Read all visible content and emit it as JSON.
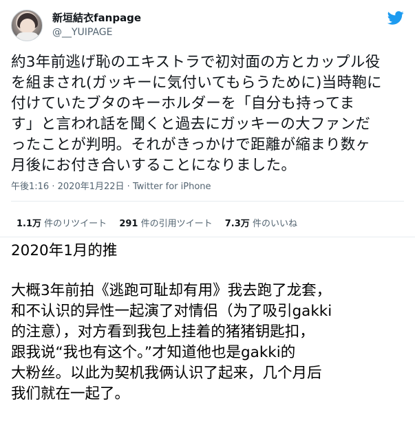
{
  "tweet": {
    "display_name": "新垣結衣fanpage",
    "handle": "@__YUIPAGE",
    "text_lines": [
      "約3年前逃げ恥のエキストラで初対面の方とカップル役",
      "を組まされ(ガッキーに気付いてもらうために)当時鞄に",
      "付けていたブタのキーホルダーを「自分も持ってま",
      "す」と言われ話を聞くと過去にガッキーの大ファンだ",
      "ったことが判明。それがきっかけで距離が縮まり数ヶ",
      "月後にお付き合いすることになりました。"
    ],
    "time": "午後1:16",
    "date": "2020年1月22日",
    "source": "Twitter for iPhone",
    "separator": "·",
    "stats": {
      "retweets_count": "1.1万",
      "retweets_label": "件のリツイート",
      "quotes_count": "291",
      "quotes_label": "件の引用ツイート",
      "likes_count": "7.3万",
      "likes_label": "件のいいね"
    },
    "brand_color": "#1d9bf0"
  },
  "caption": {
    "title": "2020年1月的推",
    "lines": [
      "大概3年前拍《逃跑可耻却有用》我去跑了龙套，",
      "和不认识的异性一起演了对情侣（为了吸引gakki",
      "的注意），对方看到我包上挂着的猪猪钥匙扣，",
      "跟我说“我也有这个。”才知道他也是gakki的",
      "大粉丝。以此为契机我俩认识了起来，几个月后",
      "我们就在一起了。"
    ]
  }
}
